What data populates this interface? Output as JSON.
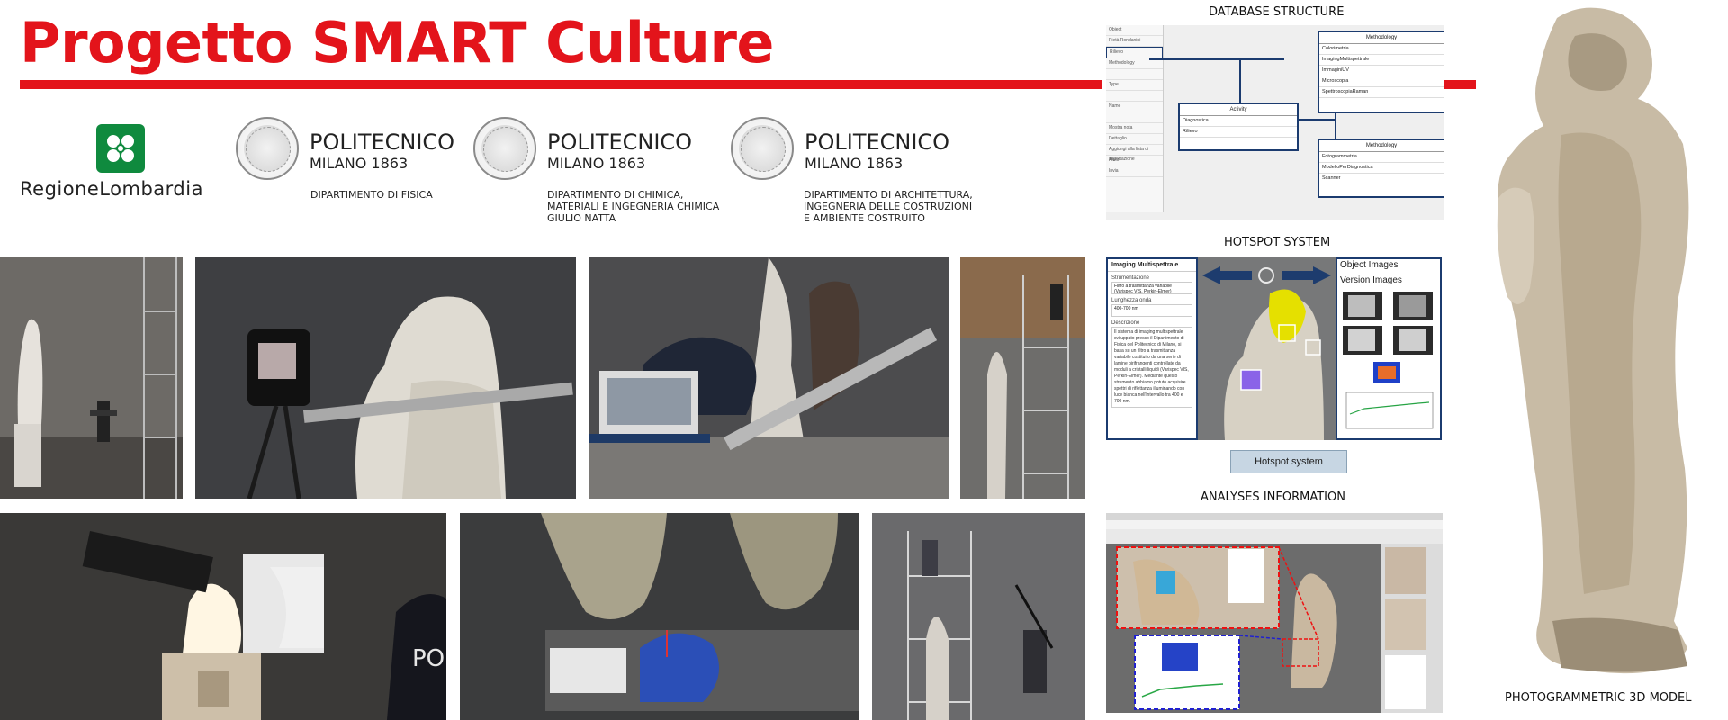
{
  "header": {
    "title": "Progetto SMART Culture",
    "accent_color": "#e3141b"
  },
  "logos": {
    "region": {
      "name": "RegioneLombardia",
      "color": "#0f8a3e",
      "icon": "lombardy-rose-icon"
    },
    "politecnico": [
      {
        "name": "POLITECNICO",
        "subtitle": "MILANO 1863",
        "department": [
          "DIPARTIMENTO DI FISICA"
        ]
      },
      {
        "name": "POLITECNICO",
        "subtitle": "MILANO 1863",
        "department": [
          "DIPARTIMENTO DI CHIMICA,",
          "MATERIALI E INGEGNERIA CHIMICA",
          "GIULIO NATTA"
        ]
      },
      {
        "name": "POLITECNICO",
        "subtitle": "MILANO 1863",
        "department": [
          "DIPARTIMENTO DI ARCHITETTURA,",
          "INGEGNERIA DELLE COSTRUZIONI",
          "E AMBIENTE COSTRUITO"
        ]
      }
    ]
  },
  "photos": {
    "overlay_text": "PO"
  },
  "database": {
    "label": "DATABASE STRUCTURE",
    "sidebar": [
      "Object",
      "Pietà Rondanini",
      "Rilievo",
      "Methodology",
      "",
      "Type",
      "",
      "Name",
      "",
      "Mostra nota",
      "Dettaglio",
      "Aggiungi alla lista di importazione",
      "Aiuto",
      "Invia"
    ],
    "boxes": [
      {
        "title": "Methodology",
        "items": [
          "Colorimetria",
          "ImagingMultispettrale",
          "ImmaginiUV",
          "Microscopia",
          "SpettroscopiaRaman"
        ]
      },
      {
        "title": "Activity",
        "items": [
          "Diagnostica",
          "Rilievo"
        ]
      },
      {
        "title": "Methodology",
        "items": [
          "Fotogrammetria",
          "ModelloPerDiagnostica",
          "Scanner"
        ]
      }
    ]
  },
  "hotspot": {
    "label": "HOTSPOT SYSTEM",
    "left_title": "Imaging Multispettrale",
    "fields": [
      {
        "label": "Strumentazione",
        "value": "Filtro a trasmittanza variabile (Varispec VIS, Perkin-Elmer)"
      },
      {
        "label": "Lunghezza onda",
        "value": "400-700 nm"
      }
    ],
    "description_label": "Descrizione",
    "description": "Il sistema di imaging multispettrale sviluppato presso il Dipartimento di Fisica del Politecnico di Milano, si basa su un filtro a trasmittanza variabile costituito da una serie di lamine birifrangenti controllate da moduli a cristalli liquidi (Varispec VIS, Perkin-Elmer). Mediante questo strumento abbiamo potuto acquisire spettri di riflettanza illuminando con luce bianca nell'intervallo tra 400 e 700 nm.",
    "right_headings": [
      "Object Images",
      "Version Images"
    ],
    "button": "Hotspot system"
  },
  "analyses": {
    "label": "ANALYSES INFORMATION"
  },
  "model": {
    "label": "PHOTOGRAMMETRIC 3D MODEL"
  }
}
